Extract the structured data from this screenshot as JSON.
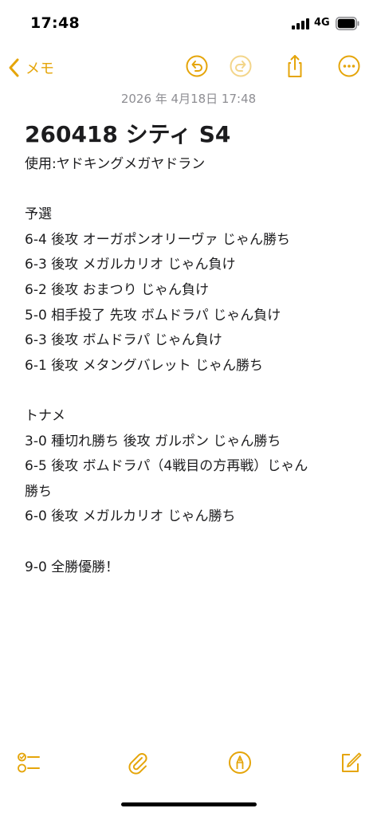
{
  "status": {
    "time": "17:48",
    "network": "4G"
  },
  "nav": {
    "back_label": "メモ"
  },
  "note": {
    "date": "2026 年 4月18日 17:48",
    "title": "260418 シティ S4",
    "lines": [
      "使用:ヤドキングメガヤドラン",
      "",
      "予選",
      "6-4 後攻 オーガポンオリーヴァ じゃん勝ち",
      "6-3 後攻 メガルカリオ じゃん負け",
      "6-2 後攻 おまつり じゃん負け",
      "5-0 相手投了 先攻 ボムドラパ じゃん負け",
      "6-3 後攻 ボムドラパ じゃん負け",
      "6-1 後攻 メタングバレット じゃん勝ち",
      "",
      "トナメ",
      "3-0 種切れ勝ち 後攻 ガルポン じゃん勝ち",
      "6-5 後攻 ボムドラパ（4戦目の方再戦）じゃん",
      "勝ち",
      "6-0 後攻 メガルカリオ じゃん勝ち",
      "",
      "9-0 全勝優勝！"
    ]
  },
  "colors": {
    "accent": "#e5a50a",
    "accent_muted": "#f3d58a",
    "text": "#1c1c1e",
    "secondary": "#8e8e93"
  },
  "icons": {
    "back": "chevron-left-icon",
    "undo": "undo-icon",
    "redo": "redo-icon",
    "share": "share-icon",
    "more": "more-icon",
    "checklist": "checklist-icon",
    "attach": "paperclip-icon",
    "markup": "markup-pen-icon",
    "compose": "compose-icon"
  }
}
